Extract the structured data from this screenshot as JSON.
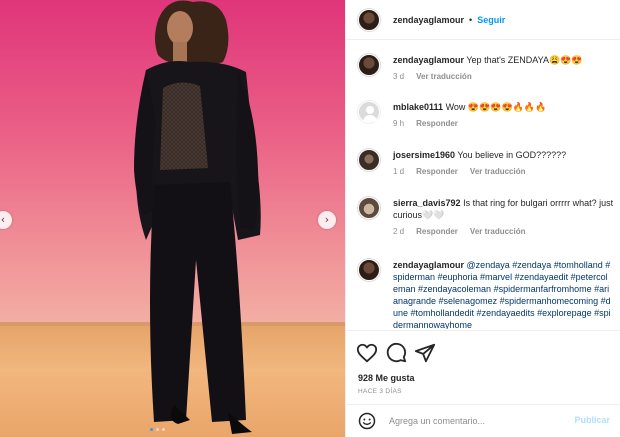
{
  "post": {
    "author": "zendayaglamour",
    "follow_label": "Seguir",
    "separator": "•",
    "more_icon": "more-horizontal-icon"
  },
  "carousel": {
    "prev_icon": "chevron-left-icon",
    "next_icon": "chevron-right-icon",
    "prev_glyph": "‹",
    "next_glyph": "›"
  },
  "comments": [
    {
      "user": "zendayaglamour",
      "text": "Yep that's ZENDAYA😩😍😍",
      "age": "3 d",
      "reply": "",
      "translate": "Ver traducción"
    },
    {
      "user": "mblake0111",
      "text": "Wow 😍😍😍😍🔥🔥🔥",
      "age": "9 h",
      "reply": "Responder",
      "translate": ""
    },
    {
      "user": "josersime1960",
      "text": "You believe in GOD??????",
      "age": "1 d",
      "reply": "Responder",
      "translate": "Ver traducción"
    },
    {
      "user": "sierra_davis792",
      "text": "Is that ring for bulgari orrrrr what? just curious🤍🤍",
      "age": "2 d",
      "reply": "Responder",
      "translate": "Ver traducción"
    },
    {
      "user": "zendayaglamour",
      "text": "@zendaya #zendaya #tomholland #spiderman #euphoria #marvel #zendayaedit #petercoleman #zendayacoleman #spidermanfarfromhome #arianagrande #selenagomez #spidermanhomecoming #dune #tomhollandedit #zendayaedits #explorepage #spidermannowayhome",
      "age": "",
      "reply": "",
      "translate": ""
    }
  ],
  "actions": {
    "like_icon": "heart-icon",
    "comment_icon": "comment-icon",
    "share_icon": "send-icon",
    "save_icon": "bookmark-icon"
  },
  "likes": "928 Me gusta",
  "timestamp": "HACE 3 DÍAS",
  "add_comment": {
    "placeholder": "Agrega un comentario...",
    "emoji_icon": "smiley-icon",
    "publish_label": "Publicar"
  },
  "colors": {
    "accent": "#0095f6",
    "muted": "#8e8e8e",
    "publish_disabled": "#b2dffc"
  }
}
